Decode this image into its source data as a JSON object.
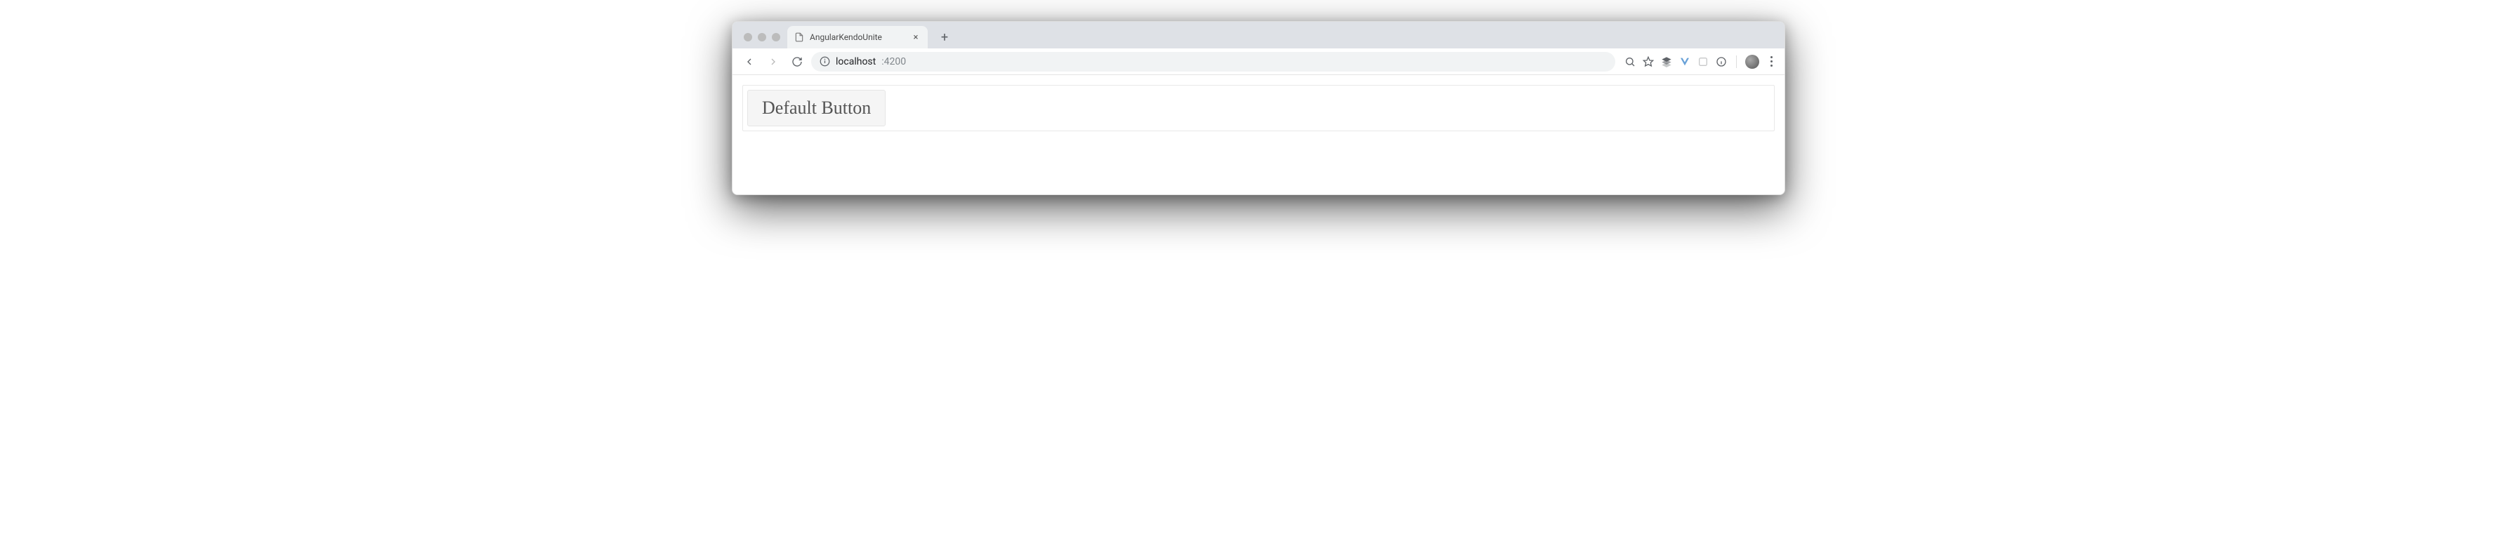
{
  "browser": {
    "tab": {
      "title": "AngularKendoUnite"
    },
    "address": {
      "host": "localhost",
      "port": ":4200"
    }
  },
  "page": {
    "default_button_label": "Default Button"
  }
}
